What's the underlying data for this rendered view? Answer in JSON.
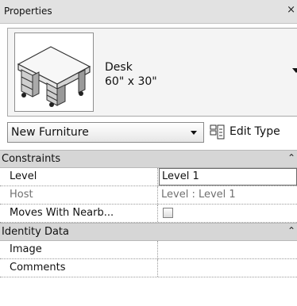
{
  "window": {
    "title": "Properties",
    "close_label": "×"
  },
  "type_preview": {
    "family_name": "Desk",
    "type_name": "60\" x 30\""
  },
  "type_selector": {
    "value": "New Furniture"
  },
  "edit_type": {
    "label": "Edit Type"
  },
  "categories": [
    {
      "name": "Constraints",
      "rows": [
        {
          "name": "Level",
          "value": "Level 1"
        },
        {
          "name": "Host",
          "value": "Level : Level 1"
        },
        {
          "name": "Moves With Nearb...",
          "checked": false
        }
      ]
    },
    {
      "name": "Identity Data",
      "rows": [
        {
          "name": "Image",
          "value": ""
        },
        {
          "name": "Comments",
          "value": ""
        }
      ]
    }
  ],
  "colors": {
    "title_bar": "#e2e2e2",
    "category_bg": "#d6d6d6"
  }
}
